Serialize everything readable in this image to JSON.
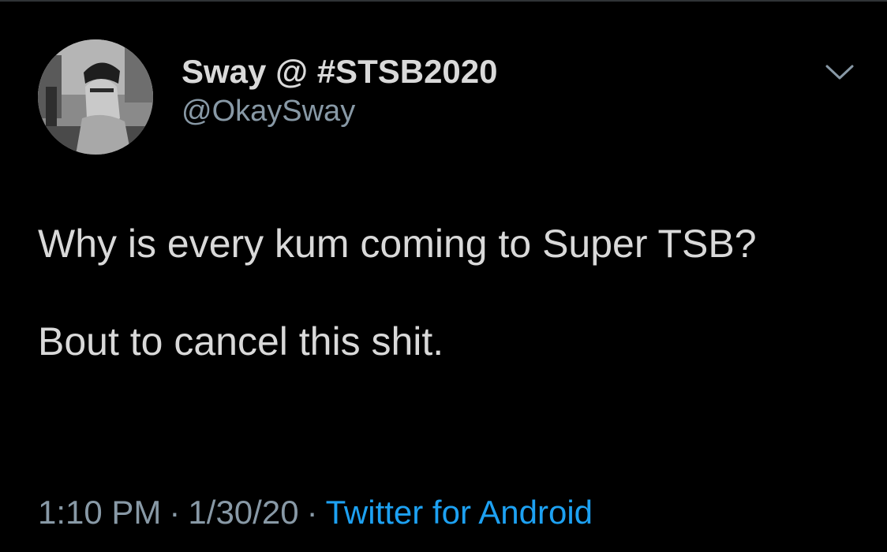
{
  "tweet": {
    "display_name": "Sway @ #STSB2020",
    "handle": "@OkaySway",
    "text_lines": [
      "Why is every kum coming to Super TSB?",
      "Bout to cancel this shit."
    ],
    "time": "1:10 PM",
    "date": "1/30/20",
    "separator": "·",
    "source": "Twitter for Android"
  },
  "icons": {
    "menu": "chevron-down-icon",
    "avatar": "avatar"
  },
  "colors": {
    "background": "#000000",
    "text": "#d9d9d9",
    "secondary": "#8899a6",
    "link": "#1da1f2"
  }
}
